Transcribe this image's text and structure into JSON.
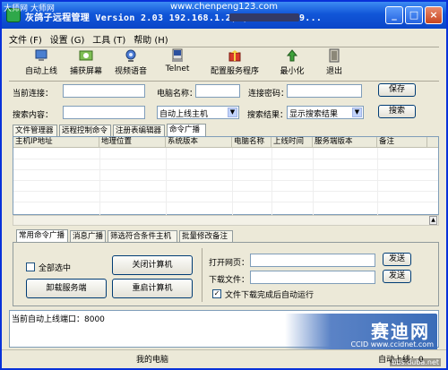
{
  "window": {
    "title": "灰鸽子远程管理  Version 2.03  192.168.1.2,                          ,192.168.19...",
    "minimize": "_",
    "maximize": "□",
    "close": "×",
    "watermark_top_left": "大师网 大师网",
    "watermark_top_url": "www.chenpeng123.com"
  },
  "menu": [
    "文件 (F)",
    "设置 (G)",
    "工具 (T)",
    "帮助 (H)"
  ],
  "toolbar": {
    "auto_online": "自动上线",
    "capture_screen": "捕获屏幕",
    "video_voice": "视频语音",
    "telnet": "Telnet",
    "config_server": "配置服务程序",
    "minimize": "最小化",
    "exit": "退出"
  },
  "form": {
    "current_conn_label": "当前连接：",
    "computer_name_label": "电脑名称：",
    "conn_password_label": "连接密码：",
    "save_button": "保存",
    "search_label": "搜索内容：",
    "search_type_value": "自动上线主机",
    "search_result_label": "搜索结果：",
    "search_result_value": "显示搜索结果",
    "search_button": "搜索"
  },
  "tabs": [
    "文件管理器",
    "远程控制命令",
    "注册表编辑器",
    "命令广播"
  ],
  "active_tab": 3,
  "grid": {
    "columns": [
      "主机IP地址",
      "地理位置",
      "系统版本",
      "电脑名称",
      "上线时间",
      "服务端版本",
      "备注"
    ]
  },
  "bottom_tabs": [
    "常用命令广播",
    "消息广播",
    "筛选符合条件主机",
    "批量修改备注"
  ],
  "broadcast": {
    "select_all": "全部选中",
    "shutdown": "关闭计算机",
    "uninstall": "卸载服务端",
    "restart": "重启计算机",
    "open_url_label": "打开网页：",
    "download_label": "下载文件：",
    "send_1": "发送",
    "send_2": "发送",
    "auto_run": "文件下载完成后自动运行"
  },
  "status": {
    "log": "当前自动上线端口：8000",
    "my_computer": "我的电脑",
    "auto_online_count": "自动上线：0"
  },
  "watermark": {
    "brand": "赛迪网",
    "url": "CCID www.ccidnet.com",
    "duba": "bbs.duba.net"
  }
}
